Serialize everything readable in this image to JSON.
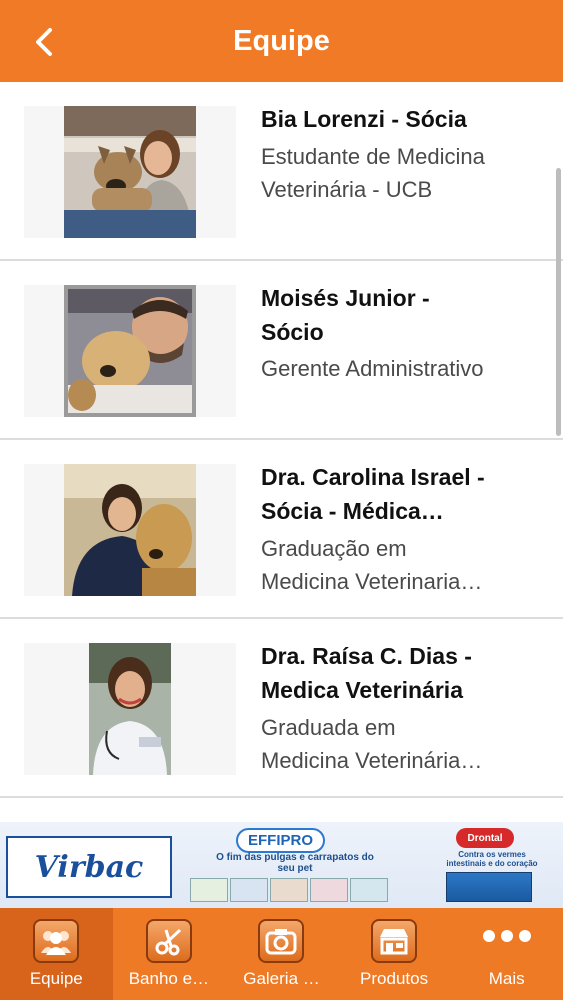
{
  "header": {
    "title": "Equipe",
    "back_icon": "chevron-left-icon"
  },
  "team": [
    {
      "name": "Bia Lorenzi - Sócia",
      "role_lines": [
        "Estudante de Medicina",
        "Veterinária - UCB"
      ]
    },
    {
      "name_lines": [
        "Moisés Junior -",
        "Sócio"
      ],
      "role_lines": [
        "Gerente Administrativo"
      ]
    },
    {
      "name_lines": [
        "Dra. Carolina Israel -",
        "Sócia - Médica…"
      ],
      "role_lines": [
        "Graduação em",
        "Medicina Veterinaria…"
      ]
    },
    {
      "name_lines": [
        "Dra. Raísa C. Dias -",
        "Medica Veterinária"
      ],
      "role_lines": [
        "Graduada em",
        "Medicina Veterinária…"
      ]
    }
  ],
  "banner": {
    "brand": "Virbac",
    "product": "EFFIPRO",
    "tagline": "O fim das pulgas e carrapatos do seu pet",
    "product2": "Drontal",
    "tagline2": "Contra os vermes intestinais e do coração"
  },
  "tabs": [
    {
      "label": "Equipe",
      "icon": "team-icon",
      "active": true
    },
    {
      "label": "Banho e…",
      "icon": "scissors-icon",
      "active": false
    },
    {
      "label": "Galeria …",
      "icon": "camera-icon",
      "active": false
    },
    {
      "label": "Produtos",
      "icon": "store-icon",
      "active": false
    },
    {
      "label": "Mais",
      "icon": "more-dots-icon",
      "active": false
    }
  ],
  "colors": {
    "accent": "#f07a25",
    "tab_active": "#d7641a",
    "divider": "#dcdcdc"
  }
}
